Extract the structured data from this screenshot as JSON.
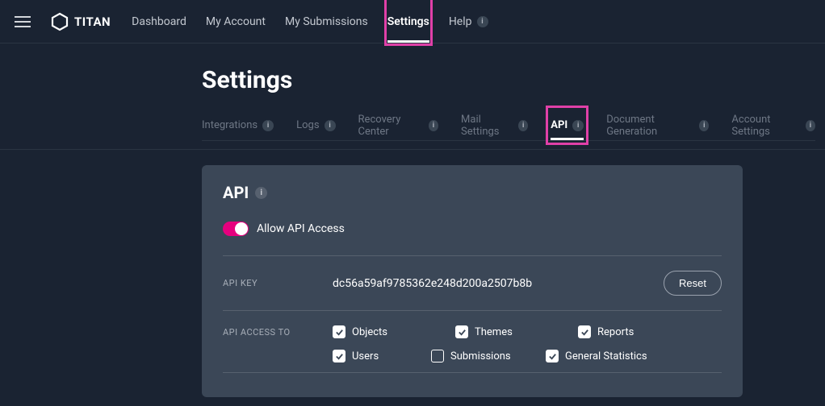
{
  "brand": {
    "name": "TITAN"
  },
  "nav": {
    "items": [
      {
        "label": "Dashboard",
        "active": false,
        "badge": false
      },
      {
        "label": "My Account",
        "active": false,
        "badge": false
      },
      {
        "label": "My Submissions",
        "active": false,
        "badge": false
      },
      {
        "label": "Settings",
        "active": true,
        "badge": false
      },
      {
        "label": "Help",
        "active": false,
        "badge": true
      }
    ]
  },
  "page": {
    "title": "Settings",
    "tabs": [
      {
        "label": "Integrations",
        "active": false
      },
      {
        "label": "Logs",
        "active": false
      },
      {
        "label": "Recovery Center",
        "active": false
      },
      {
        "label": "Mail Settings",
        "active": false
      },
      {
        "label": "API",
        "active": true
      },
      {
        "label": "Document Generation",
        "active": false
      },
      {
        "label": "Account Settings",
        "active": false
      }
    ]
  },
  "card": {
    "title": "API",
    "toggle": {
      "label": "Allow API Access",
      "on": true
    },
    "api_key": {
      "label": "API KEY",
      "value": "dc56a59af9785362e248d200a2507b8b",
      "reset_label": "Reset"
    },
    "access": {
      "label": "API ACCESS TO",
      "items": [
        {
          "label": "Objects",
          "checked": true
        },
        {
          "label": "Themes",
          "checked": true
        },
        {
          "label": "Reports",
          "checked": true
        },
        {
          "label": "Users",
          "checked": true
        },
        {
          "label": "Submissions",
          "checked": false
        },
        {
          "label": "General Statistics",
          "checked": true
        }
      ]
    }
  },
  "highlights": {
    "settings_tab": true,
    "api_tab": true
  }
}
